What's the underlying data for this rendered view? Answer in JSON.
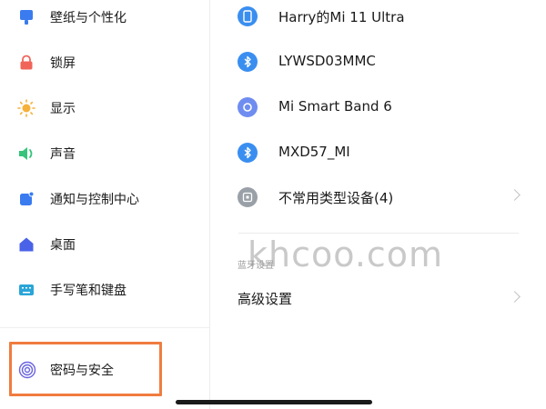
{
  "sidebar": {
    "items": [
      {
        "label": "壁纸与个性化",
        "icon": "wallpaper-icon",
        "color": "#3a7bf0"
      },
      {
        "label": "锁屏",
        "icon": "lock-icon",
        "color": "#f0645a"
      },
      {
        "label": "显示",
        "icon": "sun-icon",
        "color": "#f5b13a"
      },
      {
        "label": "声音",
        "icon": "speaker-icon",
        "color": "#35c47a"
      },
      {
        "label": "通知与控制中心",
        "icon": "notification-icon",
        "color": "#3a7bf0"
      },
      {
        "label": "桌面",
        "icon": "home-icon",
        "color": "#4a62e8"
      },
      {
        "label": "手写笔和键盘",
        "icon": "keyboard-icon",
        "color": "#2aa5d8"
      },
      {
        "label": "密码与安全",
        "icon": "fingerprint-icon",
        "color": "#6a64e0"
      }
    ],
    "highlight_color": "#f07c3f"
  },
  "devices": {
    "items": [
      {
        "label": "Harry的Mi 11 Ultra",
        "icon": "phone-icon",
        "color": "#3a8ef0"
      },
      {
        "label": "LYWSD03MMC",
        "icon": "bluetooth-icon",
        "color": "#3a8ef0"
      },
      {
        "label": "Mi Smart Band 6",
        "icon": "band-icon",
        "color": "#6f8df0"
      },
      {
        "label": "MXD57_MI",
        "icon": "bluetooth-icon",
        "color": "#3a8ef0"
      },
      {
        "label": "不常用类型设备(4)",
        "icon": "device-icon",
        "color": "#9aa0a8"
      }
    ]
  },
  "bluetooth_settings": {
    "section_label": "蓝牙设置",
    "advanced_label": "高级设置"
  },
  "watermark": "khcoo.com"
}
